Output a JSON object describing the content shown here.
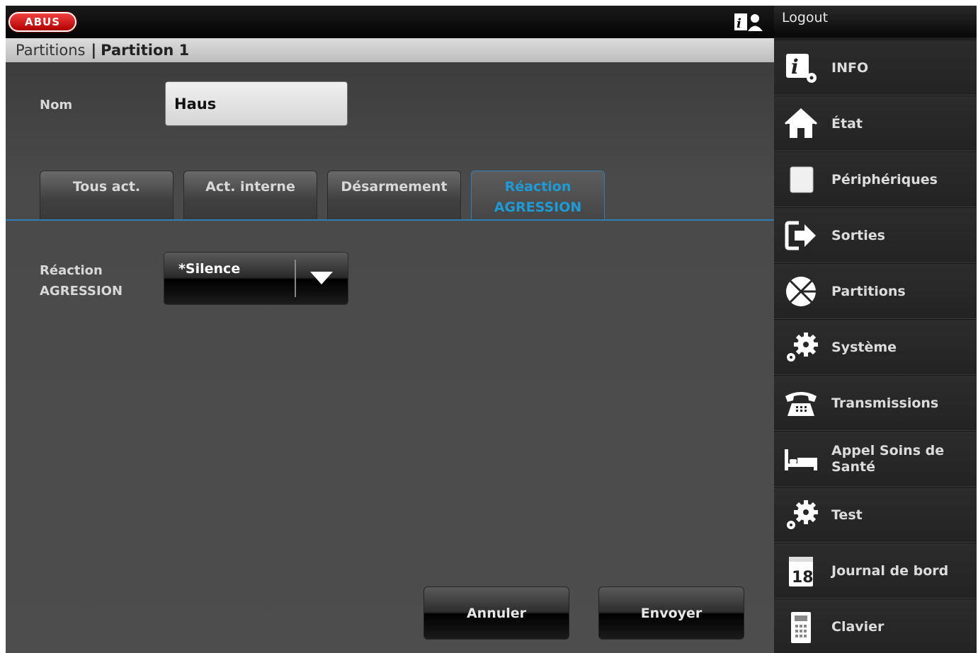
{
  "header": {
    "logo_text": "ABUS",
    "logout_label": "Logout"
  },
  "breadcrumb": {
    "parent": "Partitions",
    "separator": "|",
    "current": "Partition 1"
  },
  "form": {
    "name_label": "Nom",
    "name_value": "Haus",
    "reaction_label_line1": "Réaction",
    "reaction_label_line2": "AGRESSION",
    "reaction_value": "*Silence"
  },
  "tabs": [
    {
      "label": "Tous act.",
      "active": false
    },
    {
      "label": "Act. interne",
      "active": false
    },
    {
      "label": "Désarmement",
      "active": false
    },
    {
      "label_line1": "Réaction",
      "label_line2": "AGRESSION",
      "active": true
    }
  ],
  "buttons": {
    "cancel": "Annuler",
    "send": "Envoyer"
  },
  "sidebar": {
    "items": [
      {
        "label": "INFO",
        "icon": "info-icon"
      },
      {
        "label": "État",
        "icon": "house-icon"
      },
      {
        "label": "Périphériques",
        "icon": "device-icon"
      },
      {
        "label": "Sorties",
        "icon": "output-icon"
      },
      {
        "label": "Partitions",
        "icon": "partition-icon"
      },
      {
        "label": "Système",
        "icon": "gears-icon"
      },
      {
        "label": "Transmissions",
        "icon": "phone-icon"
      },
      {
        "label": "Appel Soins de Santé",
        "icon": "bed-icon"
      },
      {
        "label": "Test",
        "icon": "gears-icon"
      },
      {
        "label": "Journal de bord",
        "icon": "calendar-icon",
        "icon_text": "18"
      },
      {
        "label": "Clavier",
        "icon": "keypad-icon"
      }
    ]
  },
  "colors": {
    "accent": "#1e9bd7",
    "background": "#4a4a4a",
    "sidebar": "#262626",
    "logo": "#d01010"
  }
}
